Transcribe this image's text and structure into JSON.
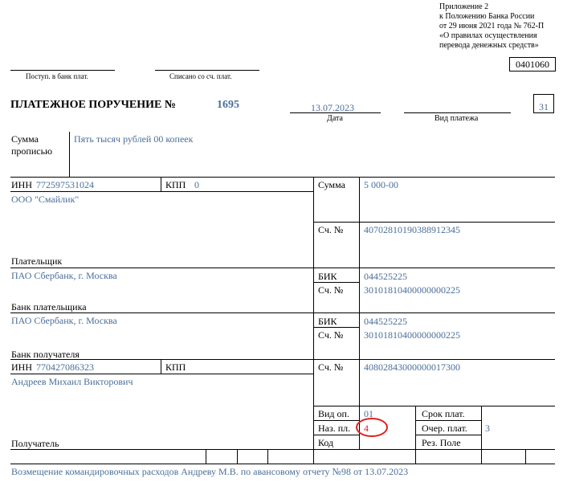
{
  "appendix": {
    "line1": "Приложение 2",
    "line2": "к Положению Банка России",
    "line3": "от 29 июня 2021 года № 762-П",
    "line4": "«О правилах осуществления",
    "line5": "перевода денежных средств»"
  },
  "form_code": "0401060",
  "header": {
    "received_label": "Поступ. в банк плат.",
    "debited_label": "Списано со сч. плат.",
    "title": "ПЛАТЕЖНОЕ ПОРУЧЕНИЕ №",
    "number": "1695",
    "date": "13.07.2023",
    "date_label": "Дата",
    "payment_type_label": "Вид платежа",
    "status_code": "31"
  },
  "amount_words": {
    "label_line1": "Сумма",
    "label_line2": "прописью",
    "value": "Пять тысяч рублей 00 копеек"
  },
  "payer": {
    "inn_label": "ИНН",
    "inn": "772597531024",
    "kpp_label": "КПП",
    "kpp": "0",
    "name": "ООО \"Смайлик\"",
    "label": "Плательщик"
  },
  "amount": {
    "label": "Сумма",
    "value": "5 000-00"
  },
  "payer_account": {
    "label": "Сч. №",
    "value": "40702810190388912345"
  },
  "payer_bank": {
    "name": "ПАО Сбербанк, г. Москва",
    "label": "Банк плательщика",
    "bik_label": "БИК",
    "bik": "044525225",
    "acc_label": "Сч. №",
    "acc": "30101810400000000225"
  },
  "payee_bank": {
    "name": "ПАО Сбербанк, г. Москва",
    "label": "Банк получателя",
    "bik_label": "БИК",
    "bik": "044525225",
    "acc_label": "Сч. №",
    "acc": "30101810400000000225"
  },
  "payee": {
    "inn_label": "ИНН",
    "inn": "770427086323",
    "kpp_label": "КПП",
    "name": "Андреев Михаил Викторович",
    "label": "Получатель",
    "acc_label": "Сч. №",
    "acc": "40802843000000017300"
  },
  "op": {
    "type_label": "Вид оп.",
    "type_value": "01",
    "purpose_label": "Наз. пл.",
    "purpose_value": "4",
    "code_label": "Код",
    "term_label": "Срок плат.",
    "priority_label": "Очер. плат.",
    "priority_value": "3",
    "reserve_label": "Рез. Поле"
  },
  "purpose_text": "Возмещение командировочных расходов Андреву М.В. по авансовому отчету №98 от 13.07.2023",
  "colors": {
    "value_blue": "#4a6e9a",
    "highlight_red": "#e0201b"
  }
}
